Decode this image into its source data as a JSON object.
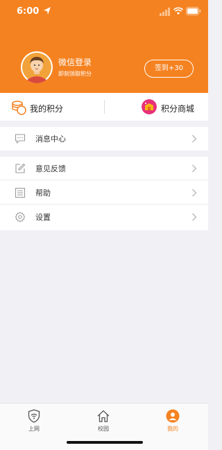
{
  "status_bar": {
    "time": "6:00"
  },
  "profile": {
    "title": "微信登录",
    "subtitle": "即刻领取积分",
    "signin_label": "签到+30"
  },
  "points": {
    "my_points": "我的积分",
    "points_mall": "积分商城"
  },
  "menu": {
    "messages": "消息中心",
    "feedback": "意见反馈",
    "help": "帮助",
    "settings": "设置"
  },
  "tabbar": {
    "items": [
      {
        "label": "上网",
        "icon": "shield-wifi-icon",
        "active": false
      },
      {
        "label": "校园",
        "icon": "home-icon",
        "active": false
      },
      {
        "label": "我的",
        "icon": "user-icon",
        "active": true
      }
    ],
    "active_color": "#f58220"
  },
  "colors": {
    "brand": "#f58220"
  }
}
